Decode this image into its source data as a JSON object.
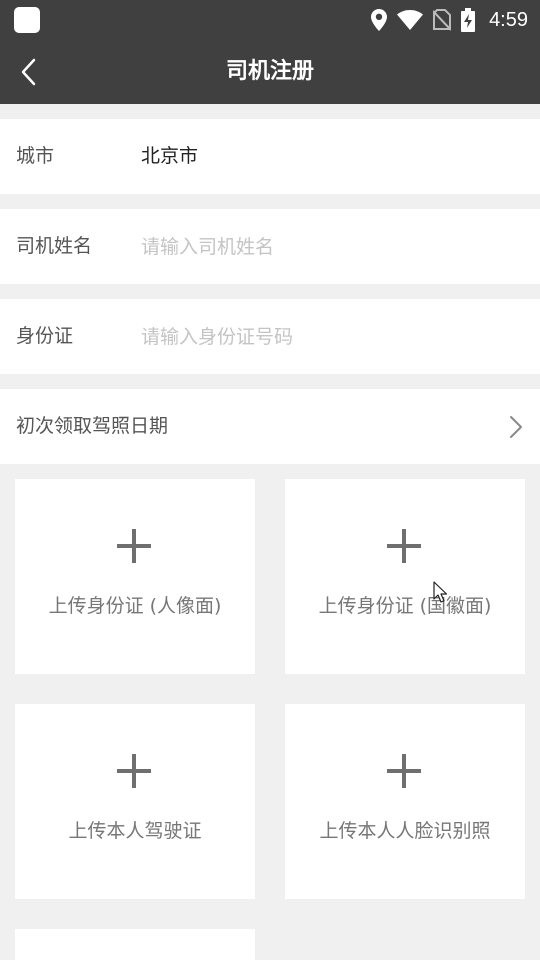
{
  "status_bar": {
    "time": "4:59",
    "icons": [
      "app-square-icon",
      "location-icon",
      "wifi-icon",
      "no-sim-icon",
      "battery-charging-icon"
    ]
  },
  "header": {
    "title": "司机注册",
    "back_icon": "chevron-left-icon"
  },
  "form": {
    "city": {
      "label": "城市",
      "value": "北京市"
    },
    "driver_name": {
      "label": "司机姓名",
      "value": "",
      "placeholder": "请输入司机姓名"
    },
    "id_card": {
      "label": "身份证",
      "value": "",
      "placeholder": "请输入身份证号码"
    },
    "license_date": {
      "label": "初次领取驾照日期",
      "icon": "chevron-right-icon"
    }
  },
  "uploads": [
    {
      "label": "上传身份证 (人像面)",
      "icon": "plus-icon"
    },
    {
      "label": "上传身份证 (国徽面)",
      "icon": "plus-icon"
    },
    {
      "label": "上传本人驾驶证",
      "icon": "plus-icon"
    },
    {
      "label": "上传本人人脸识别照",
      "icon": "plus-icon"
    }
  ],
  "colors": {
    "header_bg": "#404040",
    "page_bg": "#f0f0f0",
    "placeholder": "#c4c4c4"
  }
}
